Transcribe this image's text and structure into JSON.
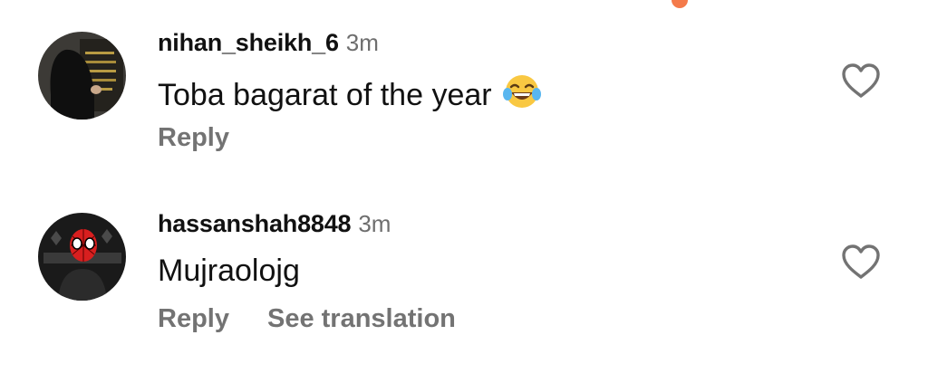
{
  "colors": {
    "username": "#111111",
    "timestamp": "#6e6e6e",
    "action_text": "#737373",
    "notification_dot": "#f47a4a"
  },
  "comments": [
    {
      "username": "nihan_sheikh_6",
      "time": "3m",
      "text": "Toba bagarat of the year",
      "emoji_icon": "face-with-tears-of-joy-icon",
      "actions": [
        "Reply"
      ],
      "like_icon": "heart-outline-icon"
    },
    {
      "username": "hassanshah8848",
      "time": "3m",
      "text": "Mujraolojg",
      "actions": [
        "Reply",
        "See translation"
      ],
      "like_icon": "heart-outline-icon"
    }
  ]
}
